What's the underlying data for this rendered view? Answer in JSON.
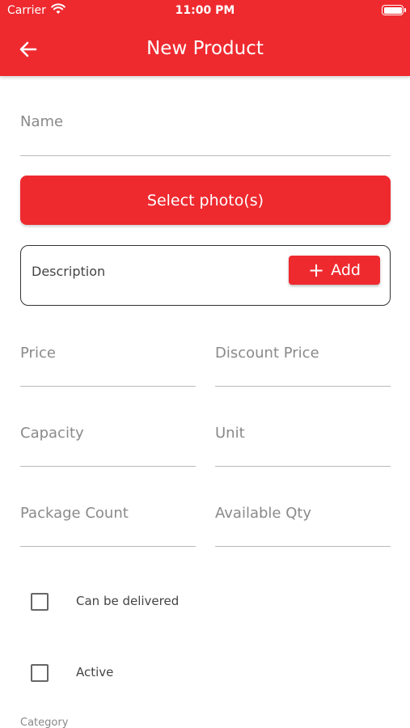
{
  "status_bar": {
    "carrier": "Carrier",
    "time": "11:00 PM"
  },
  "header": {
    "title": "New Product",
    "back_icon": "arrow-left-icon"
  },
  "form": {
    "name_label": "Name",
    "select_photos_label": "Select photo(s)",
    "description": {
      "label": "Description",
      "add_label": "Add",
      "add_icon": "plus-icon"
    },
    "price_label": "Price",
    "discount_price_label": "Discount Price",
    "capacity_label": "Capacity",
    "unit_label": "Unit",
    "package_count_label": "Package Count",
    "available_qty_label": "Available Qty",
    "can_be_delivered_label": "Can be delivered",
    "active_label": "Active",
    "category_label": "Category"
  },
  "colors": {
    "accent": "#ee2a2f",
    "field_line": "#b9b9b9",
    "label_gray": "#8a8a8a"
  }
}
